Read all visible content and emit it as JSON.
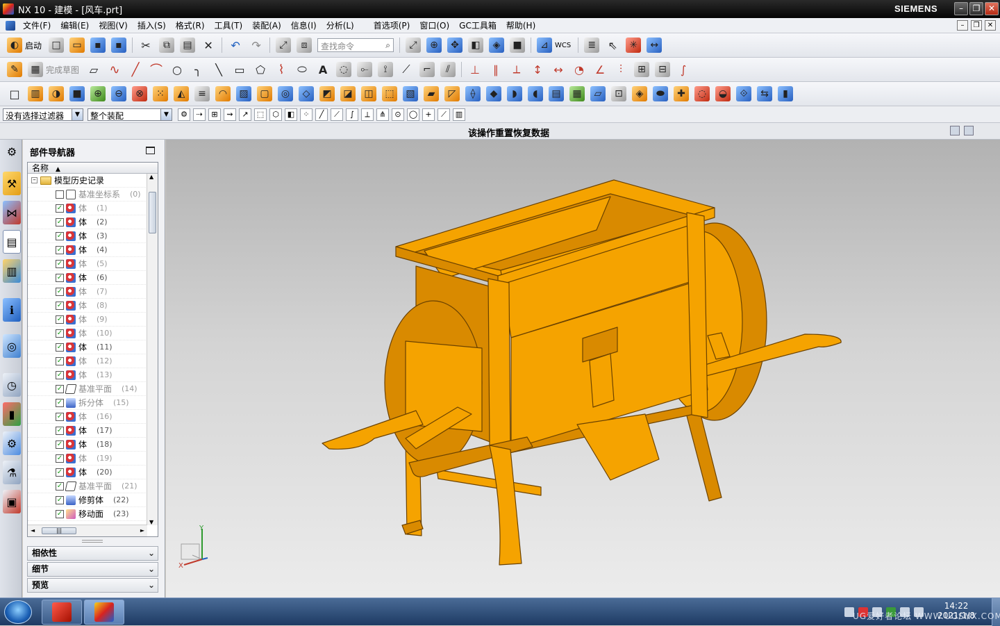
{
  "window": {
    "app_title": "NX 10 - 建模 - [风车.prt]",
    "brand": "SIEMENS",
    "minimize": "–",
    "restore": "❐",
    "close": "✕"
  },
  "menu": {
    "items": [
      "文件(F)",
      "编辑(E)",
      "视图(V)",
      "插入(S)",
      "格式(R)",
      "工具(T)",
      "装配(A)",
      "信息(I)",
      "分析(L)",
      "首选项(P)",
      "窗口(O)",
      "GC工具箱",
      "帮助(H)"
    ]
  },
  "toolbar1": {
    "start_label": "启动",
    "search_placeholder": "查找命令",
    "wcs_label": "WCS"
  },
  "toolbar2": {
    "finish_sketch_label": "完成草图"
  },
  "filterbar": {
    "selection_filter": "没有选择过滤器",
    "scope": "整个装配"
  },
  "cue_line": {
    "text": "该操作重置恢复数据"
  },
  "navigator": {
    "title": "部件导航器",
    "column_name": "名称",
    "root": "模型历史记录",
    "items": [
      {
        "label": "基准坐标系",
        "num": "(0)",
        "type": "csys",
        "checked": false,
        "dim": true
      },
      {
        "label": "体",
        "num": "(1)",
        "type": "body",
        "checked": true,
        "dim": true
      },
      {
        "label": "体",
        "num": "(2)",
        "type": "body",
        "checked": true,
        "dim": false
      },
      {
        "label": "体",
        "num": "(3)",
        "type": "body",
        "checked": true,
        "dim": false
      },
      {
        "label": "体",
        "num": "(4)",
        "type": "body",
        "checked": true,
        "dim": false
      },
      {
        "label": "体",
        "num": "(5)",
        "type": "body",
        "checked": true,
        "dim": true
      },
      {
        "label": "体",
        "num": "(6)",
        "type": "body",
        "checked": true,
        "dim": false
      },
      {
        "label": "体",
        "num": "(7)",
        "type": "body",
        "checked": true,
        "dim": true
      },
      {
        "label": "体",
        "num": "(8)",
        "type": "body",
        "checked": true,
        "dim": true
      },
      {
        "label": "体",
        "num": "(9)",
        "type": "body",
        "checked": true,
        "dim": true
      },
      {
        "label": "体",
        "num": "(10)",
        "type": "body",
        "checked": true,
        "dim": true
      },
      {
        "label": "体",
        "num": "(11)",
        "type": "body",
        "checked": true,
        "dim": false
      },
      {
        "label": "体",
        "num": "(12)",
        "type": "body",
        "checked": true,
        "dim": true
      },
      {
        "label": "体",
        "num": "(13)",
        "type": "body",
        "checked": true,
        "dim": true
      },
      {
        "label": "基准平面",
        "num": "(14)",
        "type": "plane",
        "checked": true,
        "dim": true
      },
      {
        "label": "拆分体",
        "num": "(15)",
        "type": "split",
        "checked": true,
        "dim": true
      },
      {
        "label": "体",
        "num": "(16)",
        "type": "body",
        "checked": true,
        "dim": true
      },
      {
        "label": "体",
        "num": "(17)",
        "type": "body",
        "checked": true,
        "dim": false
      },
      {
        "label": "体",
        "num": "(18)",
        "type": "body",
        "checked": true,
        "dim": false
      },
      {
        "label": "体",
        "num": "(19)",
        "type": "body",
        "checked": true,
        "dim": true
      },
      {
        "label": "体",
        "num": "(20)",
        "type": "body",
        "checked": true,
        "dim": false
      },
      {
        "label": "基准平面",
        "num": "(21)",
        "type": "plane",
        "checked": true,
        "dim": true
      },
      {
        "label": "修剪体",
        "num": "(22)",
        "type": "split",
        "checked": true,
        "dim": false
      },
      {
        "label": "移动面",
        "num": "(23)",
        "type": "move",
        "checked": true,
        "dim": false
      }
    ],
    "sections": [
      "相依性",
      "细节",
      "预览"
    ]
  },
  "triad": {
    "x": "X",
    "y": "Y"
  },
  "taskbar": {
    "time": "14:22",
    "date": "2021/1/8",
    "watermark": "UG爱好者论坛 WWW.UGSNX.COM"
  },
  "colors": {
    "model": "#f5a300",
    "model_shade": "#d98a00",
    "model_edge": "#6b4200",
    "fan": "#f2e600"
  }
}
